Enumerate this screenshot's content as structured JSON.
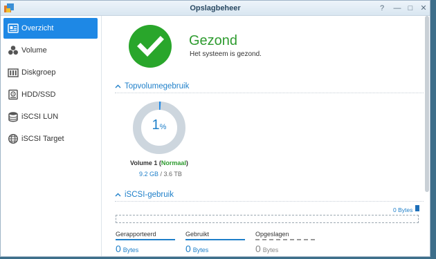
{
  "window": {
    "title": "Opslagbeheer"
  },
  "controls": {
    "help": "?",
    "minimize": "—",
    "maximize": "□",
    "close": "✕"
  },
  "sidebar": {
    "items": [
      {
        "label": "Overzicht",
        "icon": "overview-icon",
        "active": true
      },
      {
        "label": "Volume",
        "icon": "volume-icon",
        "active": false
      },
      {
        "label": "Diskgroep",
        "icon": "diskgroup-icon",
        "active": false
      },
      {
        "label": "HDD/SSD",
        "icon": "hdd-icon",
        "active": false
      },
      {
        "label": "iSCSI LUN",
        "icon": "lun-icon",
        "active": false
      },
      {
        "label": "iSCSI Target",
        "icon": "globe-icon",
        "active": false
      }
    ]
  },
  "health": {
    "title": "Gezond",
    "subtitle": "Het systeem is gezond.",
    "color": "#29a62b"
  },
  "volume_section": {
    "heading": "Topvolumegebruik",
    "usage_percent": 1,
    "percent_number": "1",
    "percent_unit": "%",
    "name": "Volume 1",
    "status": "Normaal",
    "used": "9.2 GB",
    "separator": " / ",
    "total": "3.6 TB"
  },
  "iscsi_section": {
    "heading": "iSCSI-gebruik",
    "bytes_label": "0 Bytes",
    "stats": [
      {
        "label": "Gerapporteerd",
        "value": "0",
        "unit": "Bytes"
      },
      {
        "label": "Gebruikt",
        "value": "0",
        "unit": "Bytes"
      },
      {
        "label": "Opgeslagen",
        "value": "0",
        "unit": "Bytes"
      }
    ]
  },
  "colors": {
    "accent": "#1e88e5",
    "healthy": "#2e9b2f",
    "donut_track": "#cdd6de"
  }
}
